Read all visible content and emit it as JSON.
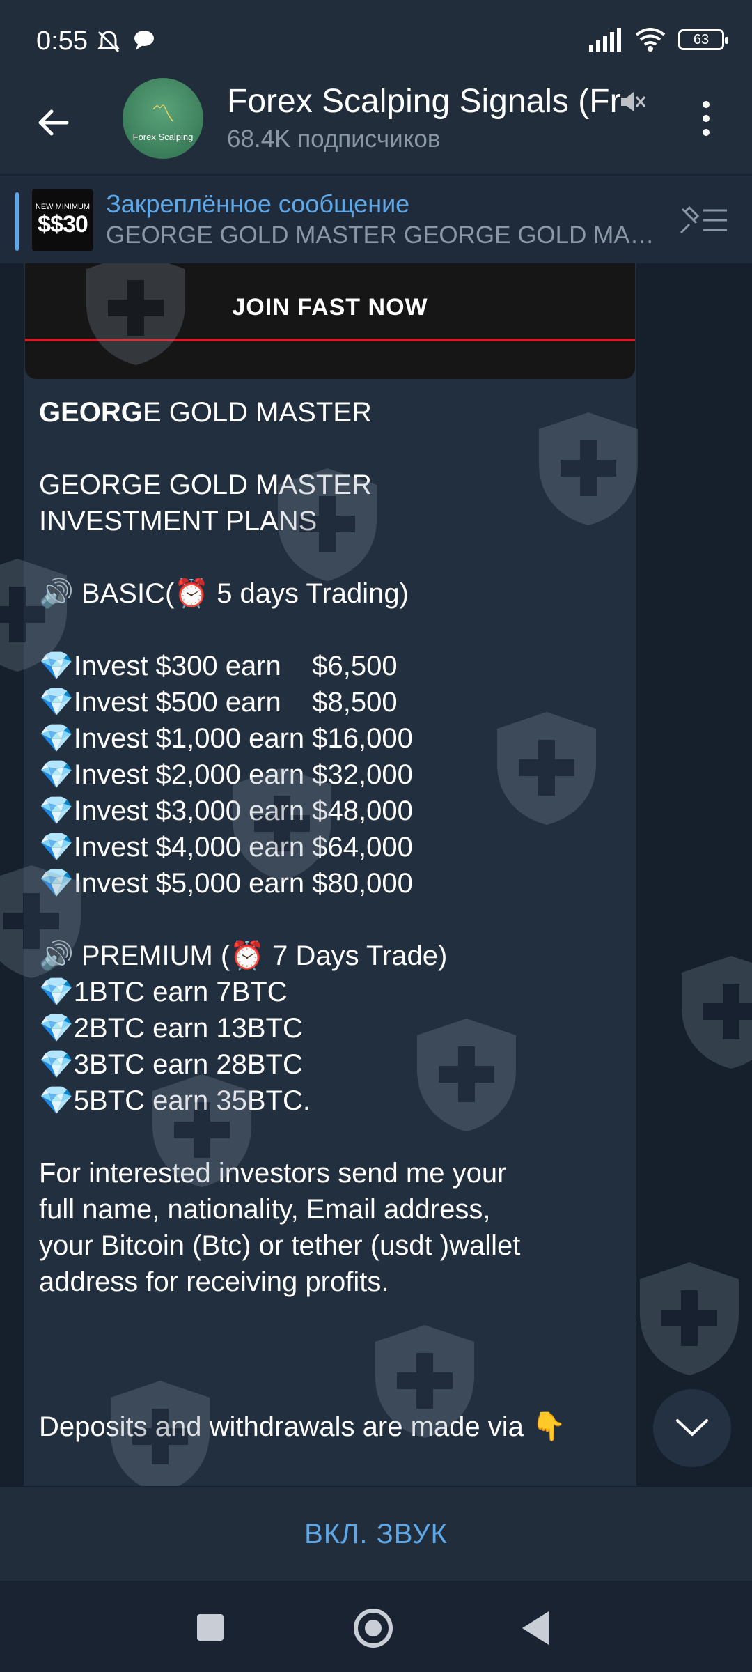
{
  "status_bar": {
    "time": "0:55",
    "battery": "63",
    "icons": [
      "mute-notification-icon",
      "chat-bubble-icon",
      "signal-icon",
      "wifi-icon",
      "battery-icon"
    ]
  },
  "header": {
    "title": "Forex Scalping Signals (Fr",
    "subscribers": "68.4K подписчиков",
    "avatar_text": "Forex Scalping"
  },
  "pinned": {
    "label": "Закреплённое сообщение",
    "text": "GEORGE GOLD MASTER   GEORGE GOLD MA…",
    "thumb_line1": "NEW MINIMUM",
    "thumb_line2": "$$30"
  },
  "media": {
    "caption": "JOIN FAST NOW"
  },
  "message": {
    "title_bold": "GEORG",
    "title_rest": "E GOLD MASTER",
    "l1": "GEORGE GOLD MASTER",
    "l2": "INVESTMENT PLANS",
    "basic": "🔊 BASIC(⏰ 5 days Trading)",
    "basic_plans": [
      "💎Invest $300 earn    $6,500",
      "💎Invest $500 earn    $8,500",
      "💎Invest $1,000 earn $16,000",
      "💎Invest $2,000 earn $32,000",
      "💎Invest $3,000 earn $48,000",
      "💎Invest $4,000 earn $64,000",
      "💎Invest $5,000 earn $80,000"
    ],
    "premium": "🔊 PREMIUM (⏰ 7 Days Trade)",
    "premium_plans": [
      "💎1BTC earn 7BTC",
      "💎2BTC earn 13BTC",
      "💎3BTC earn 28BTC",
      "💎5BTC earn 35BTC."
    ],
    "p1": "For interested investors send me your",
    "p2": "full name, nationality, Email address,",
    "p3": "your Bitcoin (Btc) or tether (usdt )wallet",
    "p4": "address for receiving profits.",
    "deposits": "Deposits and withdrawals are made via 👇"
  },
  "bottom": {
    "unmute_label": "ВКЛ. ЗВУК"
  }
}
